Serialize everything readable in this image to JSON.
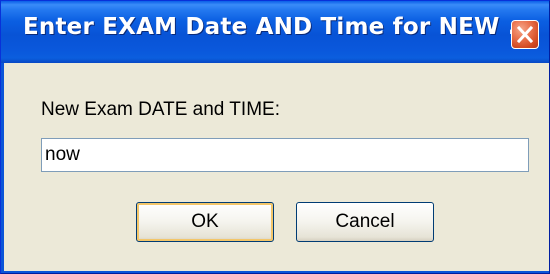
{
  "dialog": {
    "title": "Enter EXAM Date AND Time for NEW ...",
    "prompt_label": "New Exam DATE and TIME:",
    "input_value": "now",
    "ok_label": "OK",
    "cancel_label": "Cancel"
  },
  "icons": {
    "close": "close-icon"
  },
  "colors": {
    "titlebar": "#0853d6",
    "window_bg": "#ece9d8",
    "close_button": "#d24a22"
  }
}
